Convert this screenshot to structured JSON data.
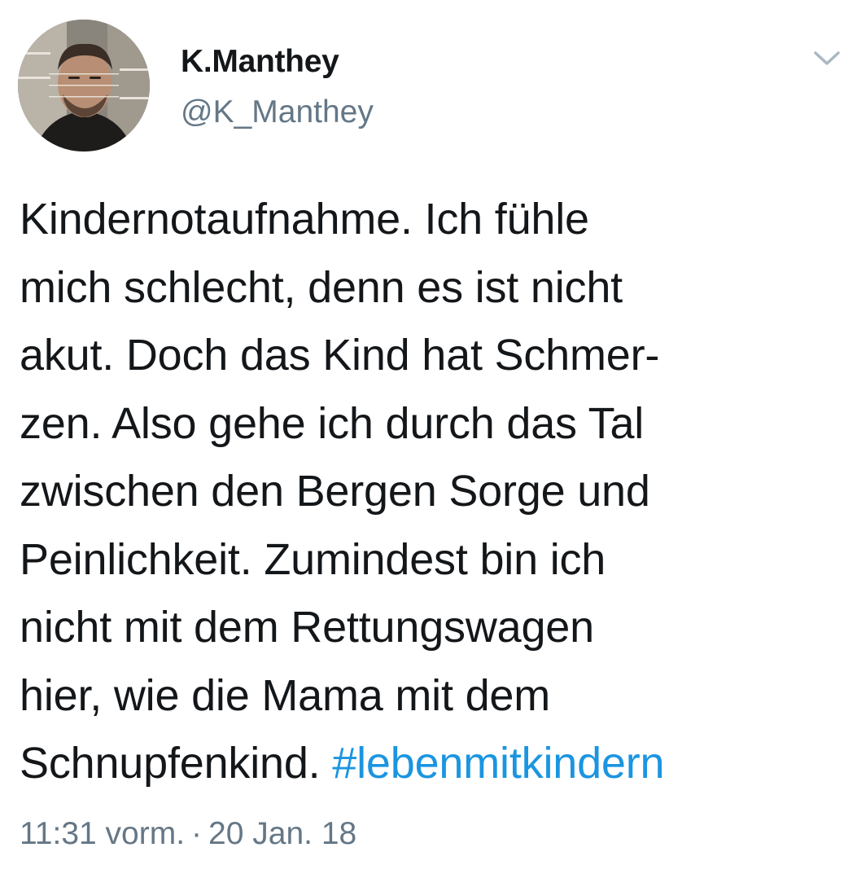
{
  "author": {
    "display_name": "K.Manthey",
    "handle": "@K_Manthey",
    "avatar_icon": "profile-photo"
  },
  "menu": {
    "icon": "chevron-down-icon"
  },
  "tweet": {
    "text": "Kindernotaufnahme. Ich fühle\nmich schlecht, denn es ist nicht\nakut. Doch das Kind hat Schmer-\nzen. Also gehe ich durch das Tal\nzwischen den Bergen Sorge und\nPeinlichkeit. Zumindest bin ich\nnicht mit dem Rettungswagen\nhier, wie die Mama mit dem\nSchnupfenkind. ",
    "hashtag": "#lebenmitkindern"
  },
  "meta": {
    "time": "11:31 vorm.",
    "separator": "·",
    "date": "20 Jan. 18"
  },
  "colors": {
    "text": "#14171a",
    "secondary": "#657786",
    "link": "#1b95e0"
  }
}
